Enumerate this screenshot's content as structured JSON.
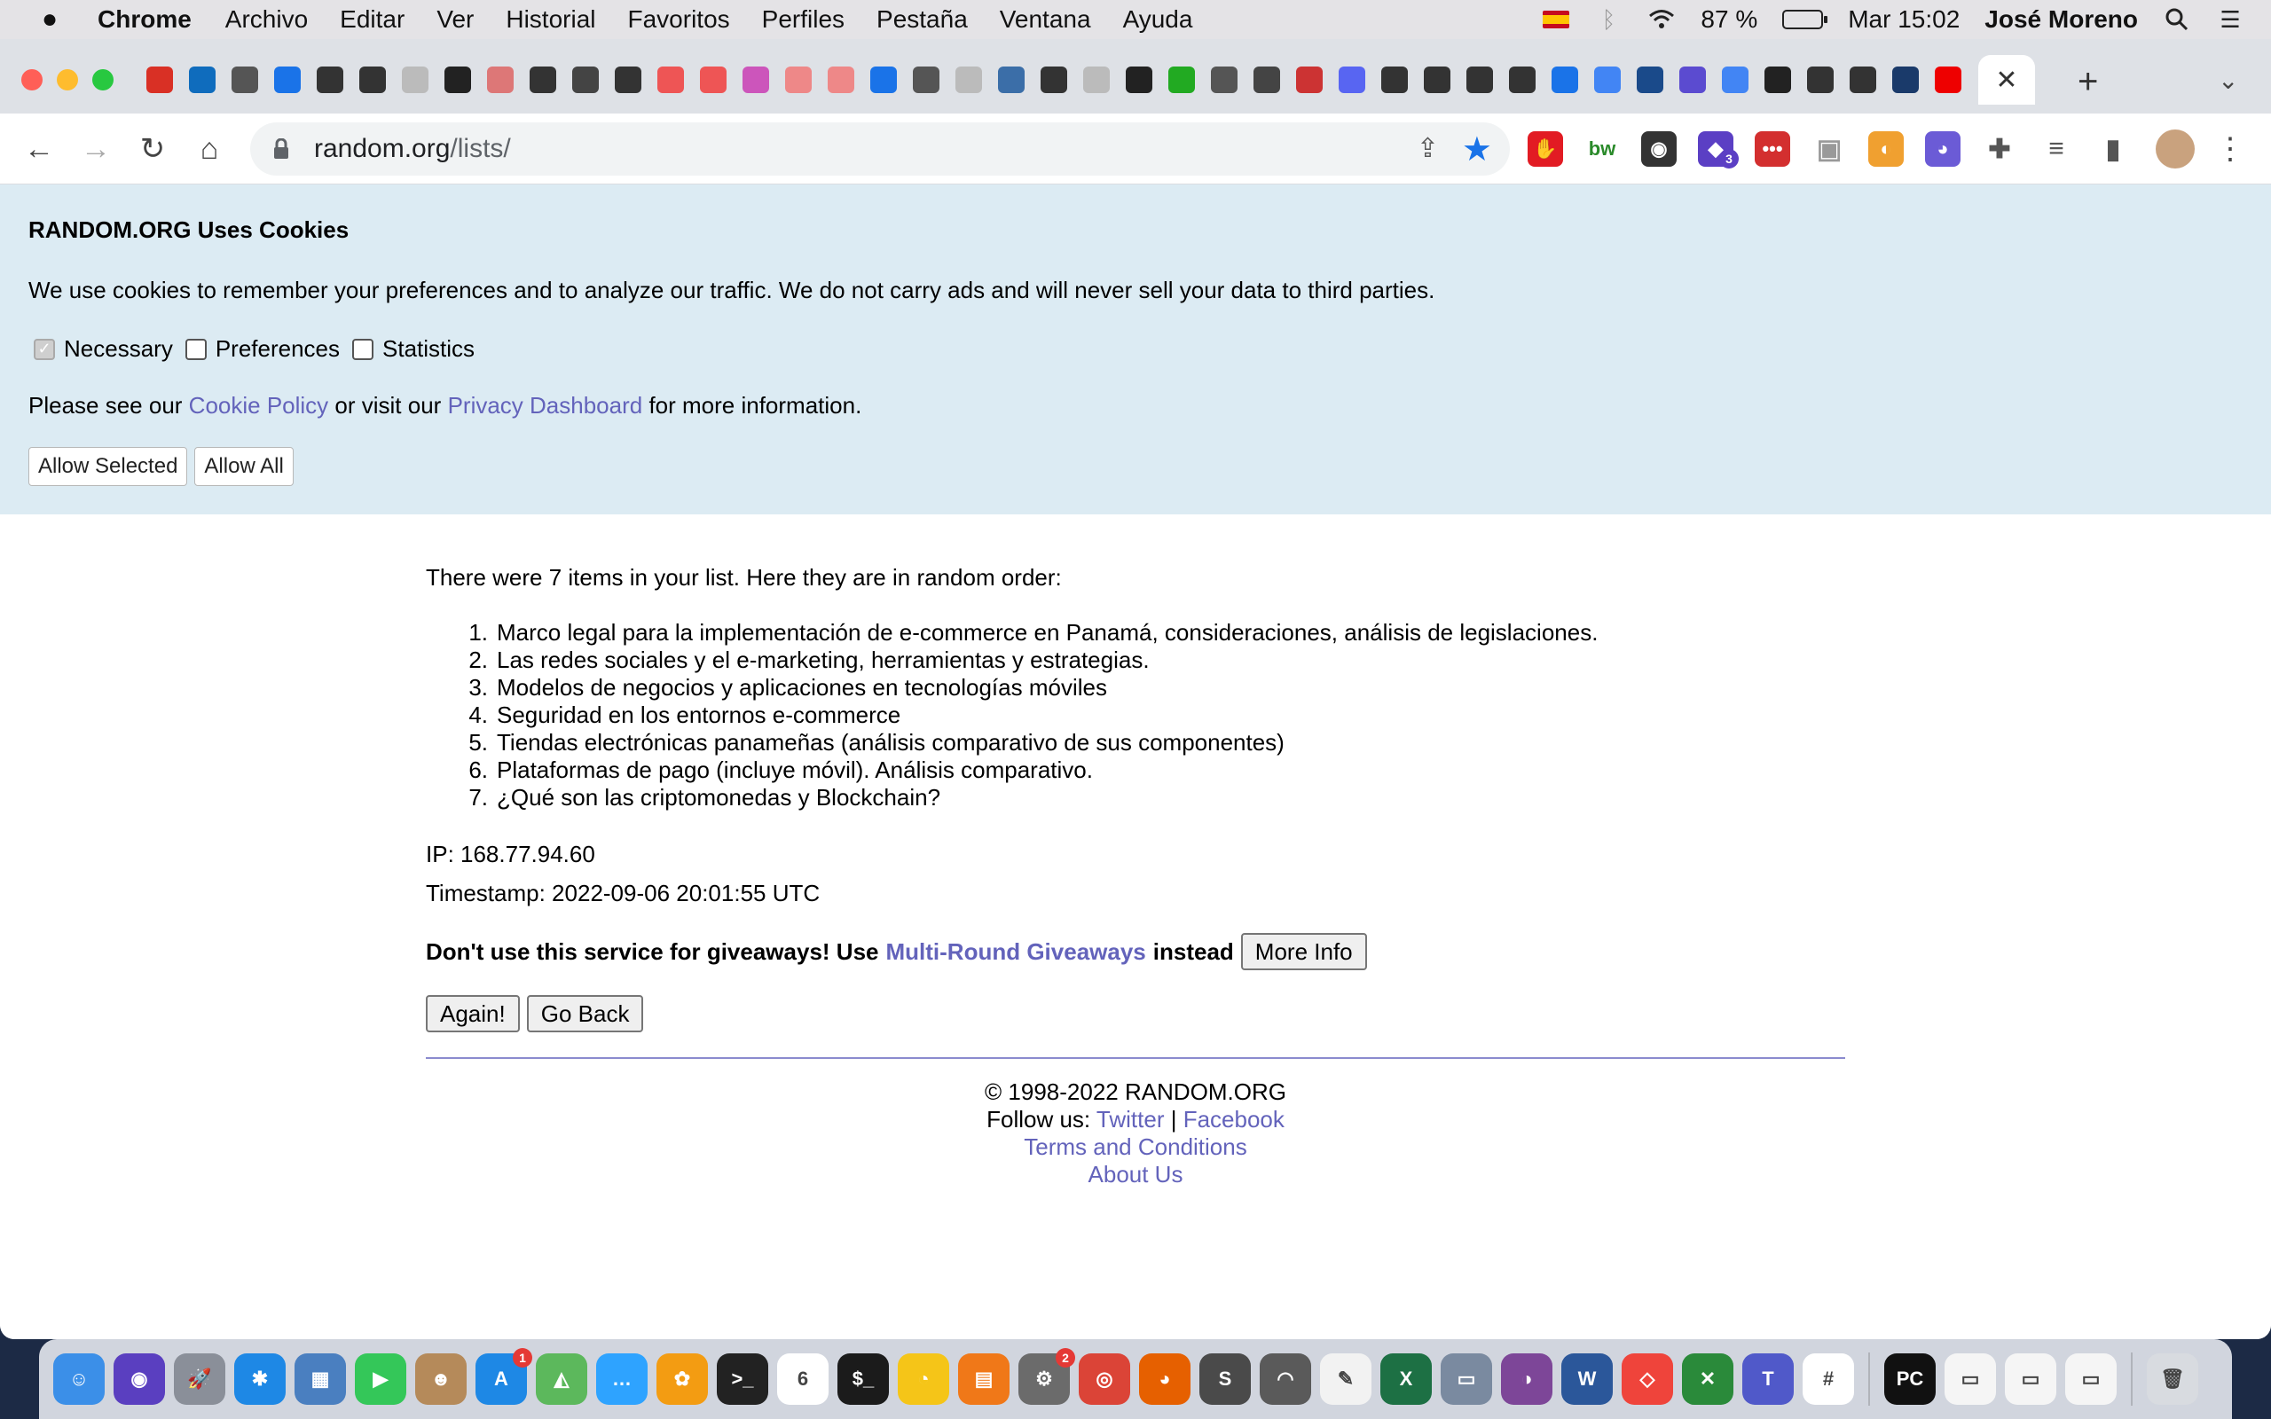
{
  "menubar": {
    "app_name": "Chrome",
    "menus": [
      "Archivo",
      "Editar",
      "Ver",
      "Historial",
      "Favoritos",
      "Perfiles",
      "Pestaña",
      "Ventana",
      "Ayuda"
    ],
    "battery": "87 %",
    "clock": "Mar 15:02",
    "user": "José Moreno"
  },
  "tabs": {
    "favicon_colors": [
      "#d93025",
      "#0f6cbd",
      "#555",
      "#1a73e8",
      "#333",
      "#333",
      "#bbb",
      "#222",
      "#d77",
      "#333",
      "#444",
      "#333",
      "#e55",
      "#e55",
      "#c5b",
      "#e88",
      "#e88",
      "#1a73e8",
      "#555",
      "#bbb",
      "#3b6ea8",
      "#333",
      "#bbb",
      "#222",
      "#2a2",
      "#555",
      "#444",
      "#c33",
      "#5865f2",
      "#333",
      "#333",
      "#333",
      "#333",
      "#1a73e8",
      "#4285f4",
      "#1a4a8a",
      "#5b4bd0",
      "#4285f4",
      "#222",
      "#333",
      "#333",
      "#1a3a6a",
      "#e00"
    ],
    "active_close": "✕",
    "new_tab": "+"
  },
  "toolbar": {
    "url_domain": "random.org",
    "url_path": "/lists/",
    "extensions": [
      {
        "name": "adblock-icon",
        "color": "#e21b23",
        "label": "✋"
      },
      {
        "name": "bw-icon",
        "color": "#ffffff",
        "label": "bw"
      },
      {
        "name": "color-picker-icon",
        "color": "#333",
        "label": "◉"
      },
      {
        "name": "graduation-icon",
        "color": "#5b3fc4",
        "label": "◆"
      },
      {
        "name": "dots-icon",
        "color": "#d32f2f",
        "label": "•••"
      },
      {
        "name": "briefcase-icon",
        "color": "#999",
        "label": "▣"
      },
      {
        "name": "fox-icon",
        "color": "#f0a030",
        "label": "◐"
      },
      {
        "name": "chat-bubble-icon",
        "color": "#6b5bd6",
        "label": "◕"
      },
      {
        "name": "puzzle-icon",
        "color": "#555",
        "label": "✚"
      },
      {
        "name": "media-icon",
        "color": "#555",
        "label": "≡"
      },
      {
        "name": "sidepanel-icon",
        "color": "#555",
        "label": "▮"
      }
    ],
    "extension_badge": "3"
  },
  "cookie": {
    "title": "RANDOM.ORG Uses Cookies",
    "description": "We use cookies to remember your preferences and to analyze our traffic. We do not carry ads and will never sell your data to third parties.",
    "checkboxes": [
      {
        "label": "Necessary",
        "checked": true
      },
      {
        "label": "Preferences",
        "checked": false
      },
      {
        "label": "Statistics",
        "checked": false
      }
    ],
    "info_prefix": "Please see our ",
    "cookie_policy_link": "Cookie Policy",
    "info_middle": " or visit our ",
    "privacy_link": "Privacy Dashboard",
    "info_suffix": " for more information.",
    "allow_selected": "Allow Selected",
    "allow_all": "Allow All"
  },
  "result": {
    "intro": "There were 7 items in your list. Here they are in random order:",
    "items": [
      "Marco legal para la implementación de e-commerce en Panamá, consideraciones, análisis de legislaciones.",
      "Las redes sociales y el e-marketing, herramientas y estrategias.",
      "Modelos de negocios y aplicaciones en tecnologías móviles",
      "Seguridad en los entornos e-commerce",
      "Tiendas electrónicas panameñas (análisis comparativo de sus componentes)",
      "Plataformas de pago (incluye móvil). Análisis comparativo.",
      "¿Qué son las criptomonedas y Blockchain?"
    ],
    "ip": "IP: 168.77.94.60",
    "timestamp": "Timestamp: 2022-09-06 20:01:55 UTC",
    "warn_prefix": "Don't use this service for giveaways! Use",
    "warn_link": "Multi-Round Giveaways",
    "warn_suffix": "instead",
    "more_info": "More Info",
    "again": "Again!",
    "go_back": "Go Back"
  },
  "footer": {
    "copyright": "© 1998-2022 RANDOM.ORG",
    "follow": "Follow us: ",
    "twitter": "Twitter",
    "separator": " | ",
    "facebook": "Facebook",
    "terms": "Terms and Conditions",
    "about": "About Us"
  },
  "dock": {
    "apps": [
      {
        "name": "finder-icon",
        "color": "#3b8fe8",
        "label": "☺"
      },
      {
        "name": "siri-icon",
        "color": "#5a3fc0",
        "label": "◉"
      },
      {
        "name": "launchpad-icon",
        "color": "#8a8f99",
        "label": "🚀"
      },
      {
        "name": "safari-icon",
        "color": "#1e88e5",
        "label": "✱"
      },
      {
        "name": "preview-icon",
        "color": "#4a7fc0",
        "label": "▦"
      },
      {
        "name": "facetime-icon",
        "color": "#34c759",
        "label": "▶"
      },
      {
        "name": "contacts-icon",
        "color": "#b58a5a",
        "label": "☻"
      },
      {
        "name": "app-store-icon",
        "color": "#1e88e5",
        "label": "A",
        "badge": "1"
      },
      {
        "name": "maps-icon",
        "color": "#5cb85c",
        "label": "◭"
      },
      {
        "name": "messages-icon",
        "color": "#2ea3ff",
        "label": "…"
      },
      {
        "name": "photos-icon",
        "color": "#f39c12",
        "label": "✿"
      },
      {
        "name": "terminal-icon",
        "color": "#222",
        "label": ">_"
      },
      {
        "name": "calendar-icon",
        "color": "#ffffff",
        "label": "6"
      },
      {
        "name": "iterm-icon",
        "color": "#1b1b1b",
        "label": "$_"
      },
      {
        "name": "cyberduck-icon",
        "color": "#f5c518",
        "label": "◔"
      },
      {
        "name": "books-icon",
        "color": "#f07818",
        "label": "▤"
      },
      {
        "name": "system-prefs-icon",
        "color": "#6b6b6b",
        "label": "⚙",
        "badge": "2"
      },
      {
        "name": "chrome-icon",
        "color": "#db4437",
        "label": "◎"
      },
      {
        "name": "firefox-icon",
        "color": "#e66000",
        "label": "◕"
      },
      {
        "name": "sublime-icon",
        "color": "#4a4a4a",
        "label": "S"
      },
      {
        "name": "tableplus-icon",
        "color": "#5a5a5a",
        "label": "◠"
      },
      {
        "name": "textedit-icon",
        "color": "#f2f2f2",
        "label": "✎"
      },
      {
        "name": "excel-icon",
        "color": "#1d7044",
        "label": "X"
      },
      {
        "name": "image-capture-icon",
        "color": "#7a8aa0",
        "label": "▭"
      },
      {
        "name": "tor-icon",
        "color": "#7d4698",
        "label": "◑"
      },
      {
        "name": "word-icon",
        "color": "#2b579a",
        "label": "W"
      },
      {
        "name": "anydesk-icon",
        "color": "#ef443b",
        "label": "◇"
      },
      {
        "name": "xcode-tools-icon",
        "color": "#2a8a3a",
        "label": "✕"
      },
      {
        "name": "teams-icon",
        "color": "#5059c9",
        "label": "T"
      },
      {
        "name": "slack-icon",
        "color": "#ffffff",
        "label": "#"
      },
      {
        "name": "pycharm-icon",
        "color": "#111",
        "label": "PC"
      },
      {
        "name": "window-thumb-1-icon",
        "color": "#f5f5f5",
        "label": "▭"
      },
      {
        "name": "window-thumb-2-icon",
        "color": "#f5f5f5",
        "label": "▭"
      },
      {
        "name": "window-thumb-3-icon",
        "color": "#f5f5f5",
        "label": "▭"
      },
      {
        "name": "trash-icon",
        "color": "#d8dbe0",
        "label": "🗑"
      }
    ]
  }
}
